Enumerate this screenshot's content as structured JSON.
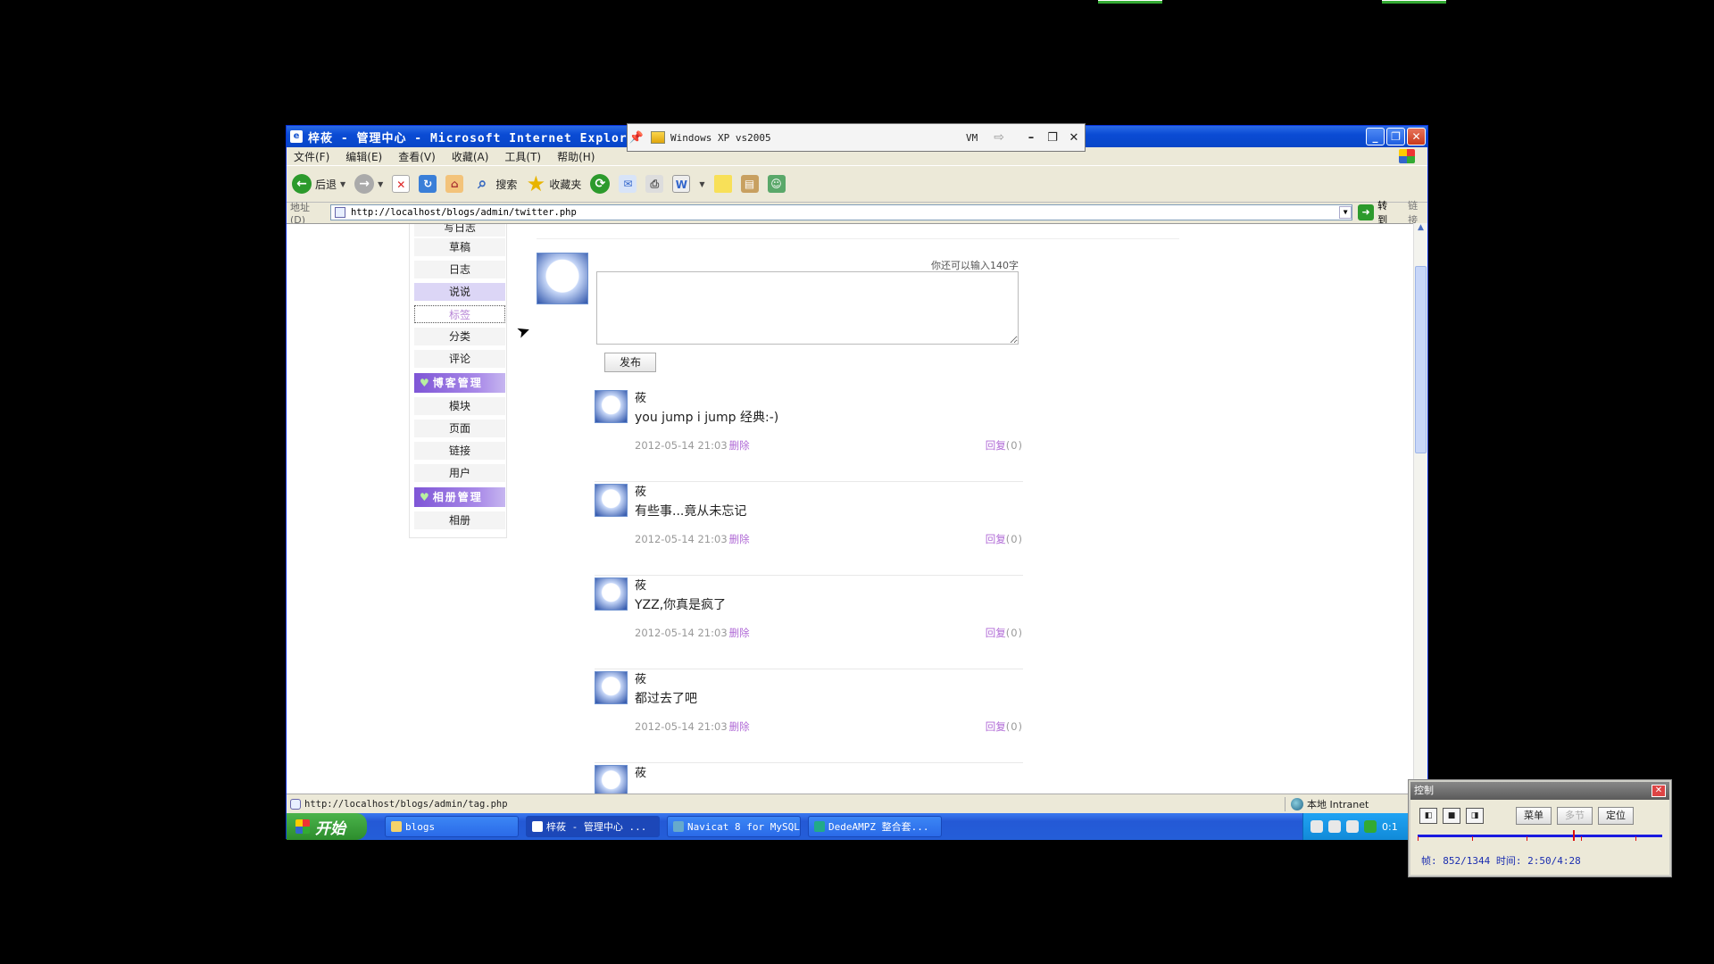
{
  "ie": {
    "title": "梓莜 - 管理中心 - Microsoft Internet Explorer",
    "menu": [
      "文件(F)",
      "编辑(E)",
      "查看(V)",
      "收藏(A)",
      "工具(T)",
      "帮助(H)"
    ],
    "toolbar": {
      "back": "后退",
      "search": "搜索",
      "favorites": "收藏夹"
    },
    "address_label": "地址(D)",
    "address_url": "http://localhost/blogs/admin/twitter.php",
    "go_label": "转到",
    "links_label": "链接",
    "status_url": "http://localhost/blogs/admin/tag.php",
    "status_zone": "本地 Intranet"
  },
  "vm_bar": {
    "title": "Windows XP vs2005",
    "menu": "VM"
  },
  "sidebar": {
    "items_top": [
      "写日志",
      "草稿",
      "日志",
      "说说",
      "标签",
      "分类",
      "评论"
    ],
    "active": "说说",
    "hovered": "标签",
    "section_blog": "博客管理",
    "items_blog": [
      "模块",
      "页面",
      "链接",
      "用户"
    ],
    "section_album": "相册管理",
    "items_album": [
      "相册"
    ]
  },
  "compose": {
    "char_hint": "你还可以输入140字",
    "textarea_value": "",
    "publish_label": "发布"
  },
  "posts": [
    {
      "author": "莜",
      "content": "you jump i jump 经典:-)",
      "date": "2012-05-14 21:03",
      "delete": "删除",
      "reply": "回复",
      "reply_count": "(0)"
    },
    {
      "author": "莜",
      "content": "有些事...竟从未忘记",
      "date": "2012-05-14 21:03",
      "delete": "删除",
      "reply": "回复",
      "reply_count": "(0)"
    },
    {
      "author": "莜",
      "content": "YZZ,你真是疯了",
      "date": "2012-05-14 21:03",
      "delete": "删除",
      "reply": "回复",
      "reply_count": "(0)"
    },
    {
      "author": "莜",
      "content": "都过去了吧",
      "date": "2012-05-14 21:03",
      "delete": "删除",
      "reply": "回复",
      "reply_count": "(0)"
    },
    {
      "author": "莜"
    }
  ],
  "taskbar": {
    "start": "开始",
    "tasks": [
      "blogs",
      "梓莜 - 管理中心 ...",
      "Navicat 8 for MySQL",
      "DedeAMPZ 整合套..."
    ],
    "tray_time": "0:1"
  },
  "control": {
    "title": "控制",
    "menu_btn": "菜单",
    "multi_btn": "多节",
    "locate_btn": "定位",
    "info": "帧: 852/1344 时间: 2:50/4:28",
    "playback_progress": 0.634
  },
  "colors": {
    "accent": "#b06ad6",
    "section": "#7e55d6",
    "xp_blue": "#245ed8"
  }
}
